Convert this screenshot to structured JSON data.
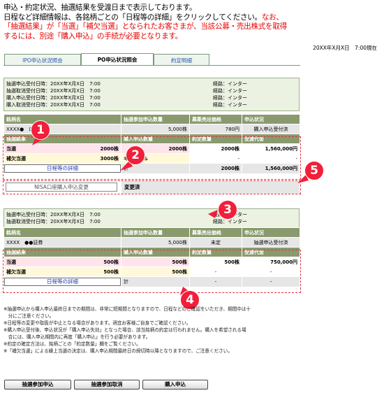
{
  "intro": {
    "line1": "申込・約定状況、抽選結果を受渡日まで表示しております。",
    "line2a": "日程など詳細情報は、各銘柄ごとの「日程等の詳細」をクリックしてください。",
    "line2b": "なお、",
    "line3": "「抽選結果」が「当選」「補欠当選」となられたお客さまが、当該公募・売出株式を取得",
    "line4": "するには、別途「購入申込」の手続が必要となります。"
  },
  "timestamp": "20XX年X月X日　7:00現在",
  "tabs": [
    "IPO申込状況照会",
    "PO申込状況照会",
    "約定明細"
  ],
  "block1": {
    "log": [
      {
        "l": "抽選申込受付日時：20XX年X月X日　7:00",
        "r": "経路：インター"
      },
      {
        "l": "抽選取消受付日時：20XX年X月X日　7:00",
        "r": "経路：インター"
      },
      {
        "l": "購入申込受付日時：20XX年X月X日　7:00",
        "r": "経路：インター"
      },
      {
        "l": "購入取消受付日時：20XX年X月X日　7:00",
        "r": "経路：インター"
      }
    ],
    "head1": [
      "銘柄名",
      "抽選参加申込数量",
      "募集売出価格",
      "申込状況"
    ],
    "row1": [
      "XXXX●　ロ",
      "5,000株",
      "780円",
      "購入申込受付済"
    ],
    "head2": [
      "抽選結果",
      "購入申込数量",
      "約定数量",
      "受渡代金"
    ],
    "rows": [
      [
        "当選",
        "2000株",
        "2000株",
        "2000株",
        "1,560,000円"
      ],
      [
        "補欠当選",
        "3000株",
        "キャンセル",
        "-",
        "-"
      ]
    ],
    "detail_link": "日程等の詳細",
    "total_label": "計",
    "total_qty": "2000株",
    "total_amt": "1,560,000円",
    "nisa_button": "NISA口座購入申込変更",
    "changed": "変更済"
  },
  "block2": {
    "log": [
      {
        "l": "抽選申込受付日時：20XX年X月X日　7:00",
        "r": "経路：インター"
      },
      {
        "l": "抽選取消受付日時：20XX年X月X日　7:00",
        "r": "経路：インター"
      }
    ],
    "head1": [
      "銘柄名",
      "抽選参加申込数量",
      "募集売出価格",
      "申込状況"
    ],
    "row1": [
      "XXXX　●●証券",
      "5,000株",
      "未定",
      "抽選申込受付済"
    ],
    "head2": [
      "抽選結果",
      "購入申込数量",
      "約定数量",
      "受渡代金"
    ],
    "rows": [
      [
        "当選",
        "500株",
        "500株",
        "500株",
        "750,000円"
      ],
      [
        "補欠当選",
        "500株",
        "500株",
        "-",
        "-"
      ]
    ],
    "detail_link": "日程等の詳細",
    "total_label": "計",
    "total_qty": "-",
    "total_amt": "-"
  },
  "markers": [
    "1",
    "2",
    "3",
    "4",
    "5"
  ],
  "notes": [
    "※抽選申込から購入申込最終日までの期間は、非常に短期間となりますので、日程などのご確認をいただき、期間中は十",
    "　分にご注意ください。",
    "※日程等の変更や取扱が中止となる場合があります。適宜お客様ご自身でご確認ください。",
    "※購入申込受付後、申込状況が「購入申込失効」となった場合、該当銘柄の約定は行われません。購入を希望される場",
    "　合には、購入申込期間内に再度「購入申込」を行う必要があります。",
    "※約定の確定方法は、銘柄ごとの「約定数量」欄をご覧ください。",
    "※「補欠当選」による繰上当選の決定は、購入申込期間最終日の締切時以降となりますので、ご注意ください。"
  ],
  "buttons": [
    "抽選参加申込",
    "抽選参加取消",
    "購入申込"
  ]
}
